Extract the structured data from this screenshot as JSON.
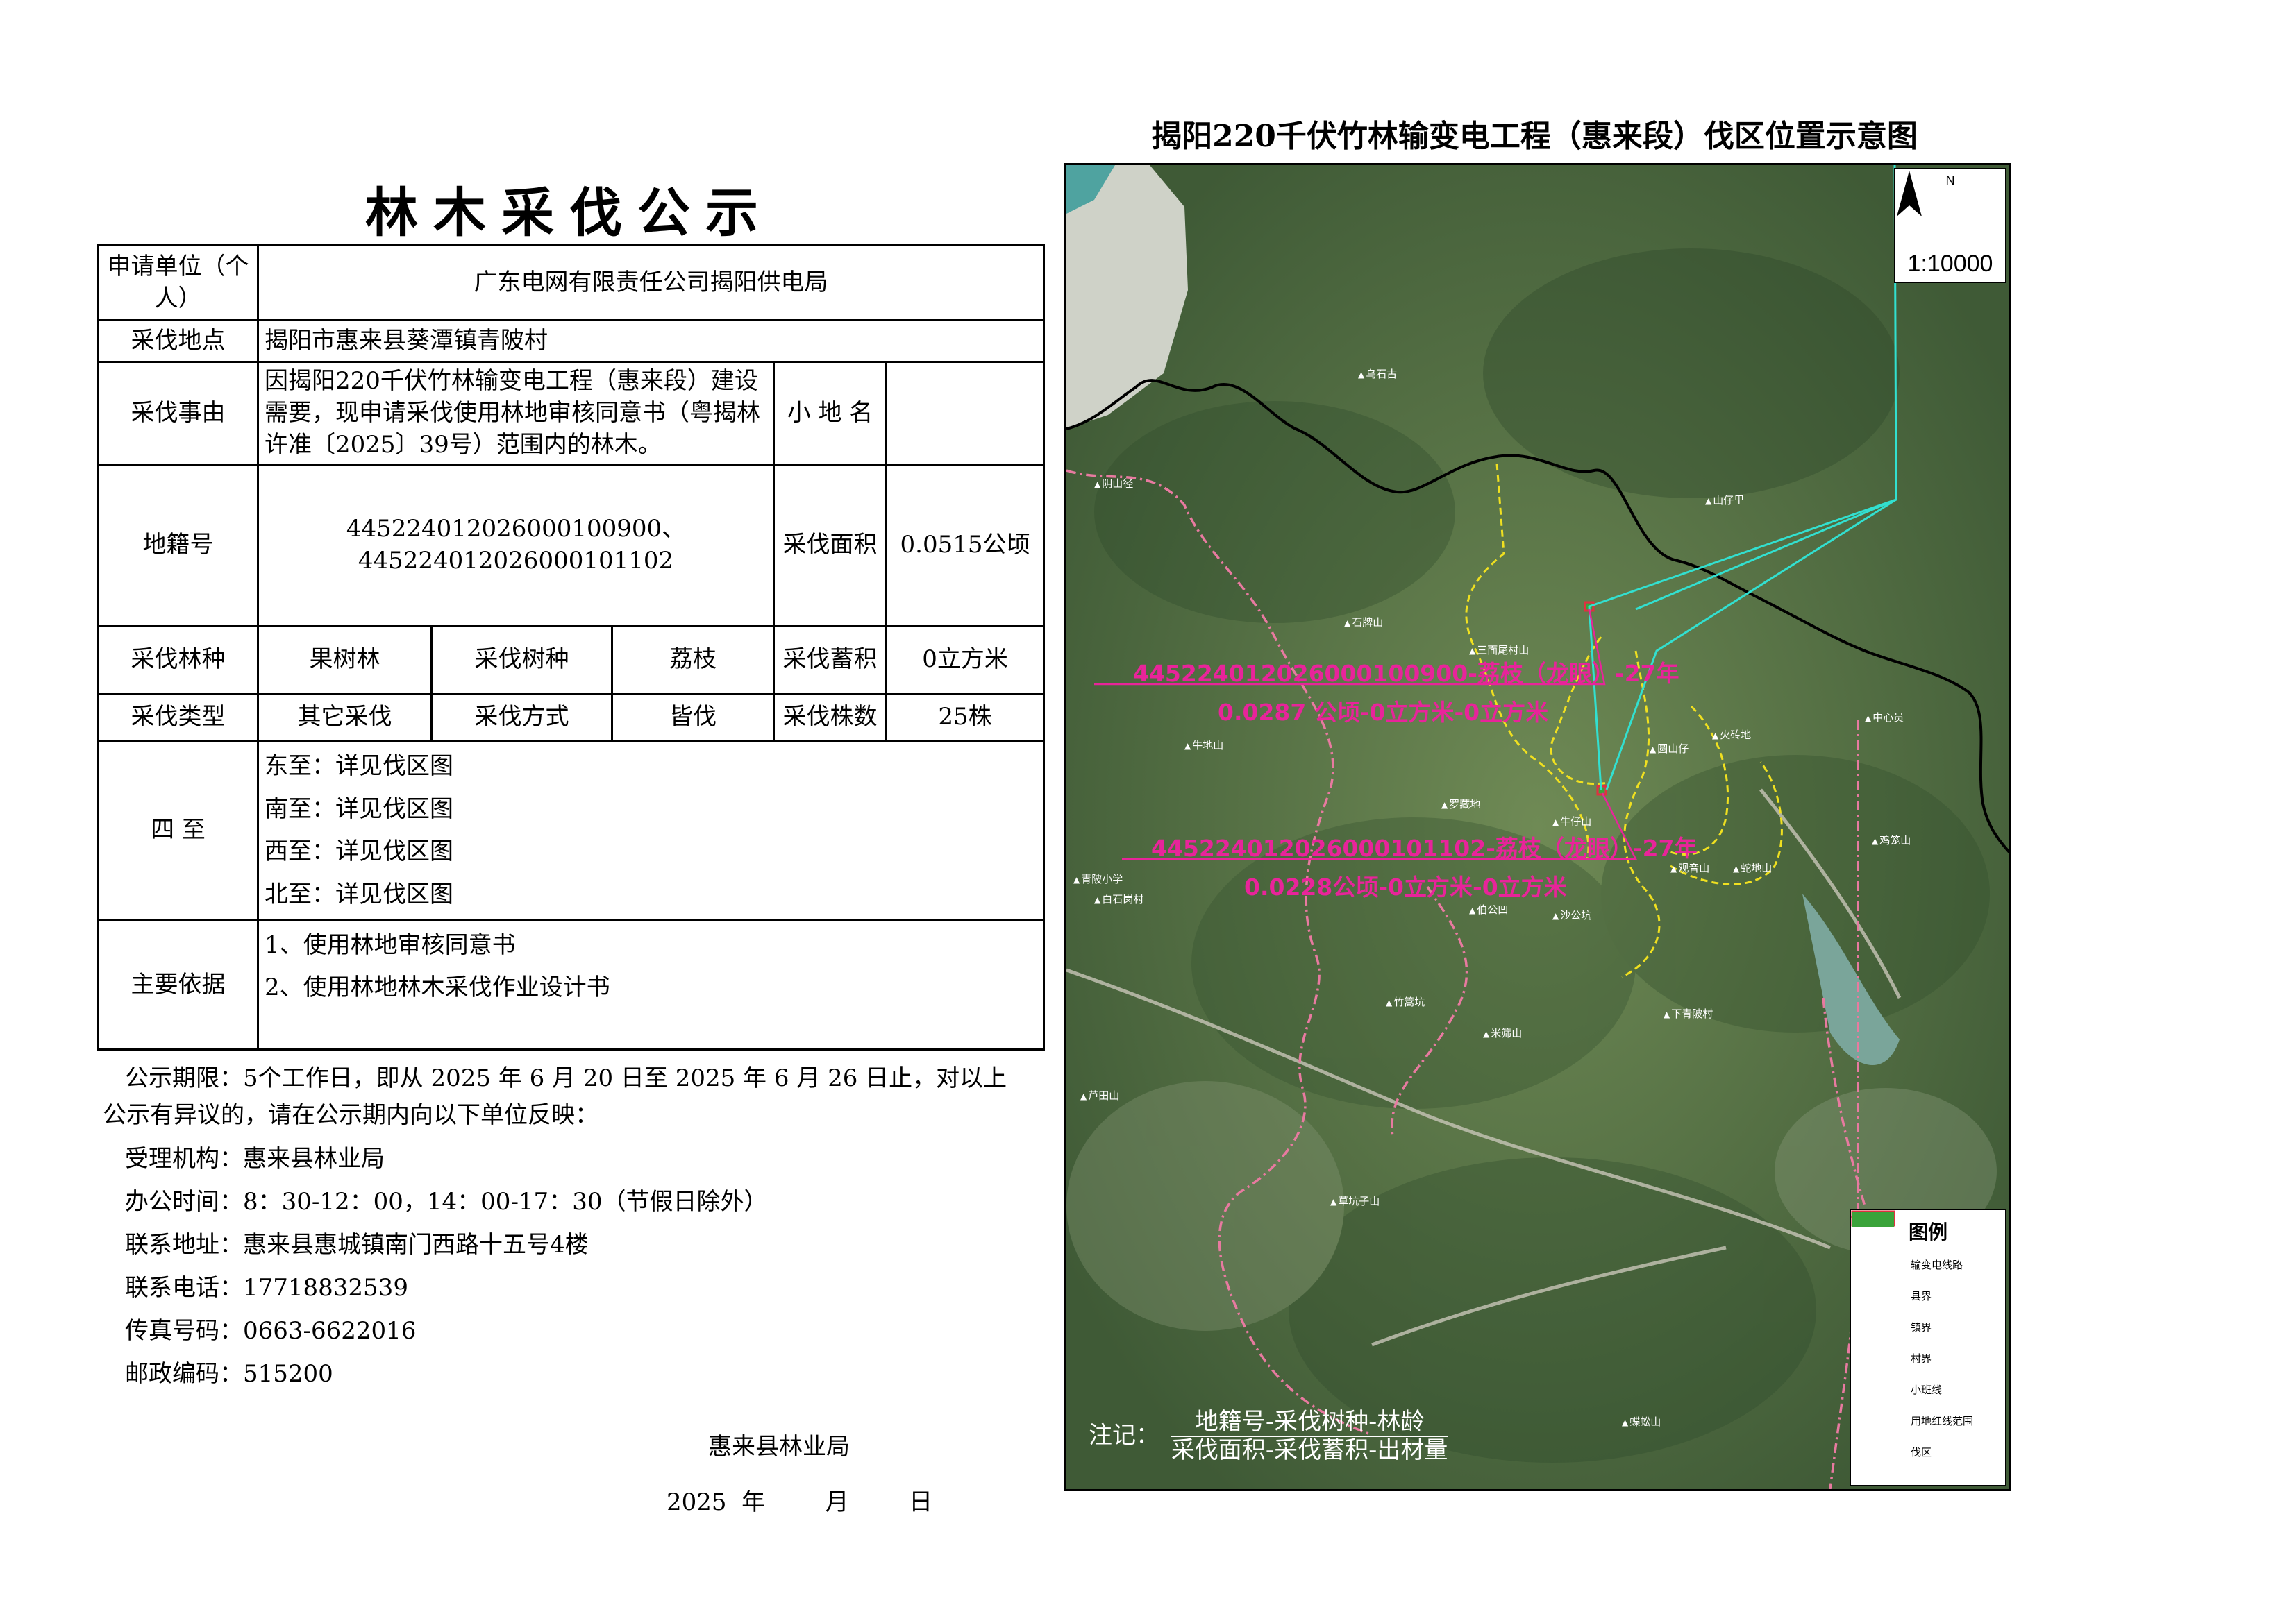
{
  "notice": {
    "title": "林木采伐公示",
    "applicant_label": "申请单位（个人）",
    "applicant_value": "广东电网有限责任公司揭阳供电局",
    "location_label": "采伐地点",
    "location_value": "揭阳市惠来县葵潭镇青陂村",
    "reason_label": "采伐事由",
    "reason_value": "因揭阳220千伏竹林输变电工程（惠来段）建设需要，现申请采伐使用林地审核同意书（粤揭林许准〔2025〕39号）范围内的林木。",
    "subplace_label": "小 地 名",
    "subplace_value": "",
    "parcel_label": "地籍号",
    "parcel_value_1": "445224012026000100900、",
    "parcel_value_2": "445224012026000101102",
    "area_label": "采伐面积",
    "area_value": "0.0515公顷",
    "forest_type_label": "采伐林种",
    "forest_type_value": "果树林",
    "species_label": "采伐树种",
    "species_value": "荔枝",
    "volume_label": "采伐蓄积",
    "volume_value": "0立方米",
    "cut_type_label": "采伐类型",
    "cut_type_value": "其它采伐",
    "method_label": "采伐方式",
    "method_value": "皆伐",
    "count_label": "采伐株数",
    "count_value": "25株",
    "bounds_label": "四  至",
    "bounds": [
      "东至：详见伐区图",
      "南至：详见伐区图",
      "西至：详见伐区图",
      "北至：详见伐区图"
    ],
    "basis_label": "主要依据",
    "basis": [
      "1、使用林地审核同意书",
      "2、使用林地林木采伐作业设计书"
    ]
  },
  "footer": {
    "period_1": "公示期限：5个工作日，即从 2025 年  6  月  20  日至 2025 年  6  月  26  日止，对以上",
    "period_2": "公示有异议的，请在公示期内向以下单位反映：",
    "agency": "受理机构：惠来县林业局",
    "hours": "办公时间：8：30-12：00，14：00-17：30（节假日除外）",
    "address": "联系地址：惠来县惠城镇南门西路十五号4楼",
    "phone": "联系电话：17718832539",
    "fax": "传真号码：0663-6622016",
    "postcode": "邮政编码：515200",
    "signature": "惠来县林业局",
    "date": "2025  年        月        日"
  },
  "map": {
    "title": "揭阳220千伏竹林输变电工程（惠来段）伐区位置示意图",
    "north": "N",
    "scale": "1:10000",
    "parcel_1_line1": "445224012026000100900-荔枝（龙眼）-27年",
    "parcel_1_line2": "0.0287 公顷-0立方米-0立方米",
    "parcel_2_line1": "445224012026000101102-荔枝（龙眼）-27年",
    "parcel_2_line2": "0.0228公顷-0立方米-0立方米",
    "places": [
      "乌石古",
      "山仔里",
      "阴山径",
      "石牌山",
      "三面尾村山",
      "中心员",
      "火砖地",
      "圆山仔",
      "牛地山",
      "罗藏地",
      "牛仔山",
      "观音山",
      "蛇地山",
      "鸡笼山",
      "白石岗村",
      "青陂小学",
      "伯公凹",
      "沙公坑",
      "竹篙坑",
      "下青陂村",
      "米筛山",
      "芦田山",
      "草坑子山",
      "蝶蚣山"
    ],
    "note_label": "注记：",
    "note_top": "地籍号-采伐树种-林龄",
    "note_bottom": "采伐面积-采伐蓄积-出材量",
    "legend": {
      "title": "图例",
      "items": [
        "输变电线路",
        "县界",
        "镇界",
        "村界",
        "小班线",
        "用地红线范围",
        "伐区"
      ]
    },
    "colors": {
      "powerline": "#32e0d0",
      "county": "#000000",
      "town": "#c8102e",
      "village": "#e87aa0",
      "subcompartment": "#f0e020",
      "redline": "#e03040",
      "cut_area": "#3aa33a",
      "annotation": "#e8249a"
    }
  }
}
